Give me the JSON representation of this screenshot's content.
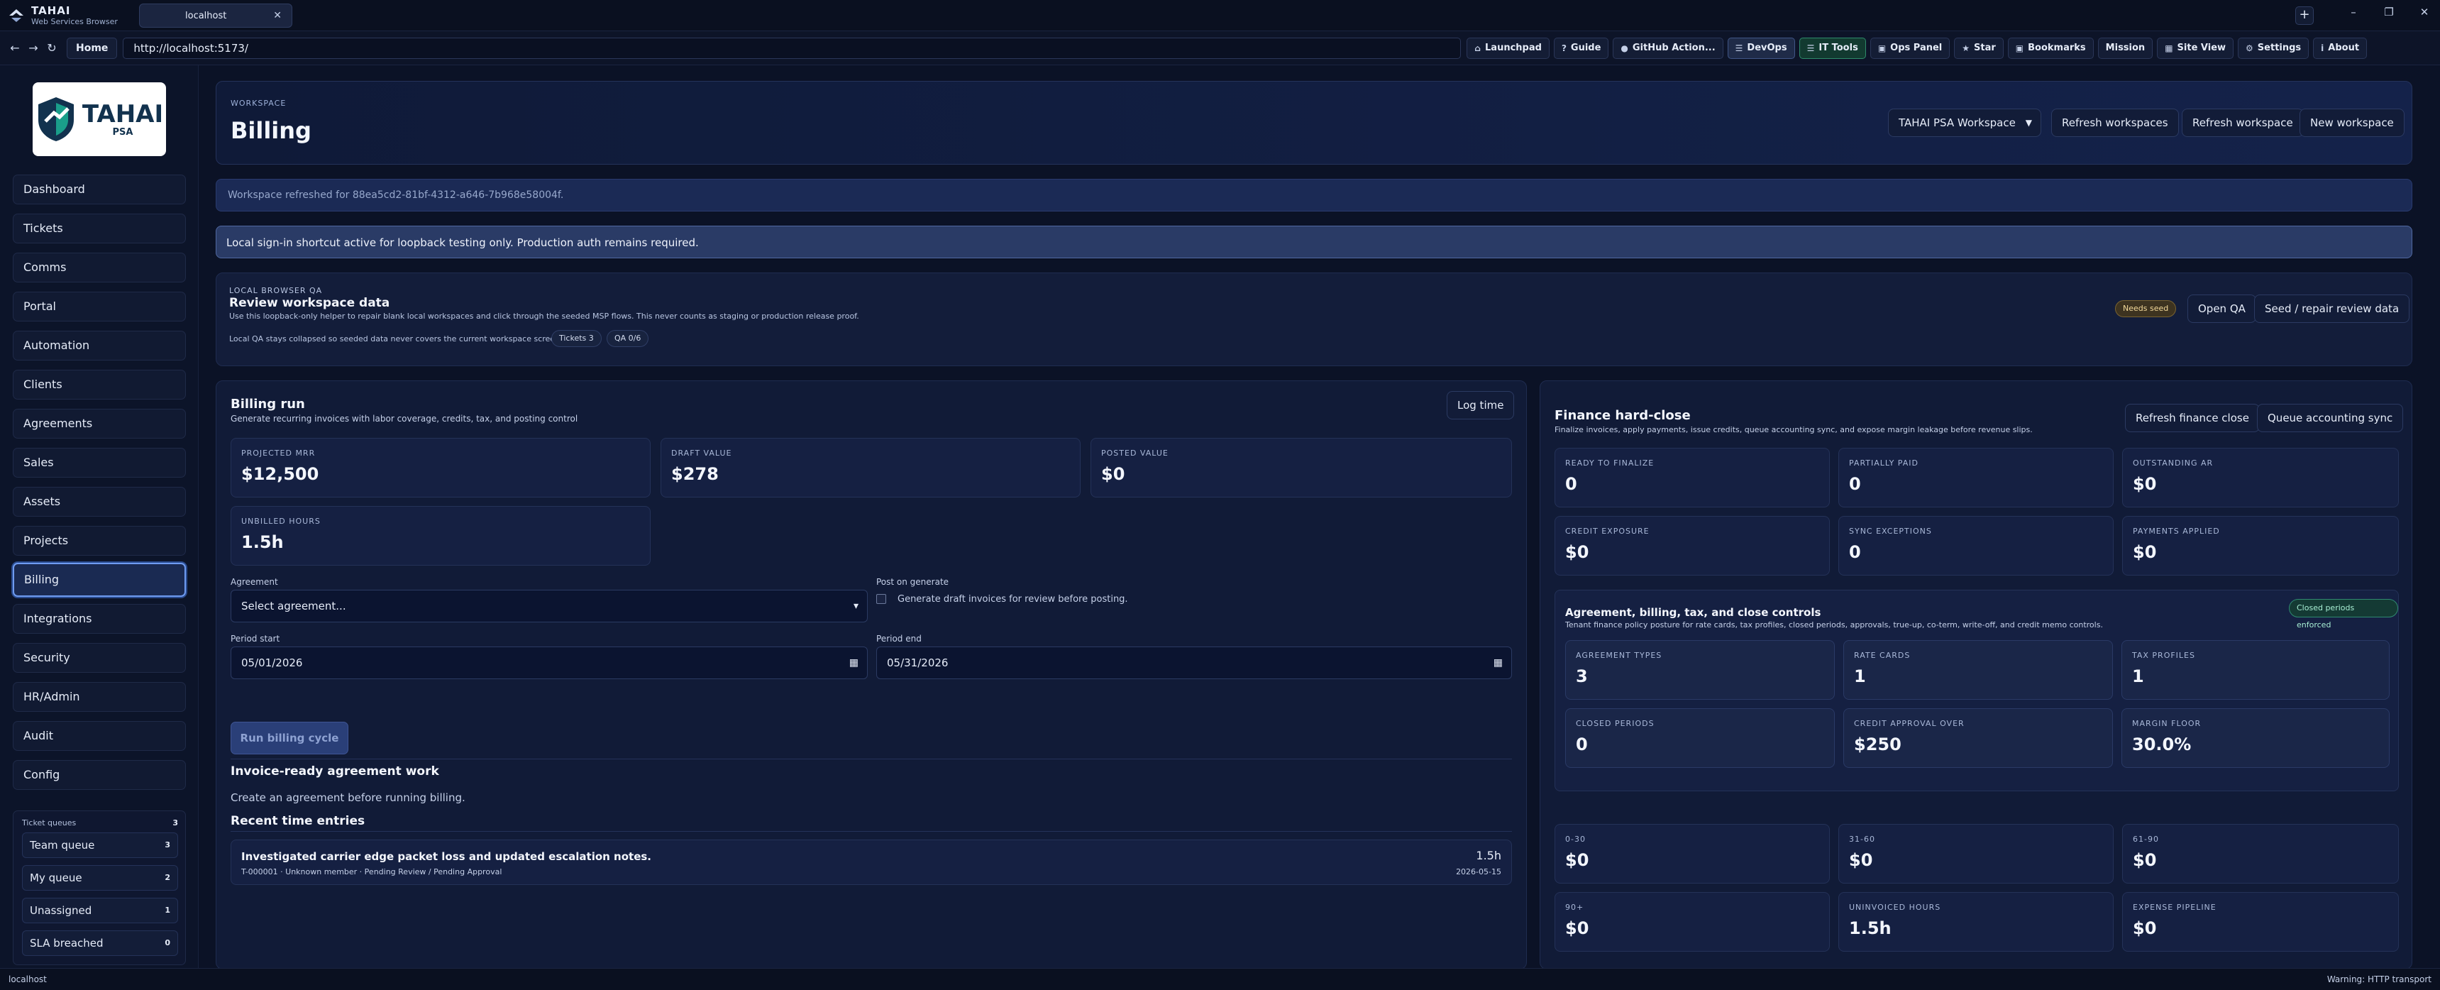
{
  "browser": {
    "brand_name": "TAHAI",
    "brand_sub": "Web Services Browser",
    "tab_title": "localhost",
    "url": "http://localhost:5173/",
    "home_label": "Home",
    "tools": [
      {
        "label": "Launchpad",
        "icon": "⌂"
      },
      {
        "label": "Guide",
        "icon": "?"
      },
      {
        "label": "GitHub Action...",
        "icon": "●"
      },
      {
        "label": "DevOps",
        "icon": "☰"
      },
      {
        "label": "IT Tools",
        "icon": "☰"
      },
      {
        "label": "Ops Panel",
        "icon": "▣"
      },
      {
        "label": "Star",
        "icon": "★"
      },
      {
        "label": "Bookmarks",
        "icon": "▣"
      },
      {
        "label": "Mission",
        "icon": ""
      },
      {
        "label": "Site View",
        "icon": "▦"
      },
      {
        "label": "Settings",
        "icon": "⚙"
      },
      {
        "label": "About",
        "icon": "i"
      }
    ],
    "status_left": "localhost",
    "status_right": "Warning: HTTP transport"
  },
  "app": {
    "logo_text": "TAHAI",
    "logo_sub": "PSA"
  },
  "sidebar": {
    "items": [
      "Dashboard",
      "Tickets",
      "Comms",
      "Portal",
      "Automation",
      "Clients",
      "Agreements",
      "Sales",
      "Assets",
      "Projects",
      "Billing",
      "Integrations",
      "Security",
      "HR/Admin",
      "Audit",
      "Config"
    ],
    "active": "Billing",
    "queues": {
      "title": "Ticket queues",
      "count": "3",
      "items": [
        {
          "label": "Team queue",
          "count": "3"
        },
        {
          "label": "My queue",
          "count": "2"
        },
        {
          "label": "Unassigned",
          "count": "1"
        },
        {
          "label": "SLA breached",
          "count": "0"
        }
      ]
    }
  },
  "header": {
    "eyebrow": "WORKSPACE",
    "title": "Billing",
    "workspace_select": "TAHAI PSA Workspace",
    "refresh_workspaces": "Refresh workspaces",
    "refresh_workspace": "Refresh workspace",
    "new_workspace": "New workspace"
  },
  "notices": {
    "refreshed": "Workspace refreshed for 88ea5cd2-81bf-4312-a646-7b968e58004f.",
    "signin": "Local sign-in shortcut active for loopback testing only. Production auth remains required."
  },
  "qa": {
    "eyebrow": "LOCAL BROWSER QA",
    "title": "Review workspace data",
    "desc": "Use this loopback-only helper to repair blank local workspaces and click through the seeded MSP flows. This never counts as staging or production release proof.",
    "desc2": "Local QA stays collapsed so seeded data never covers the current workspace screen.",
    "pill_tickets": "Tickets 3",
    "pill_qa": "QA 0/6",
    "needs_seed": "Needs seed",
    "open_qa": "Open QA",
    "seed_repair": "Seed / repair review data"
  },
  "billing": {
    "title": "Billing run",
    "subtitle": "Generate recurring invoices with labor coverage, credits, tax, and posting control",
    "log_time": "Log time",
    "stats": [
      {
        "label": "PROJECTED MRR",
        "value": "$12,500"
      },
      {
        "label": "DRAFT VALUE",
        "value": "$278"
      },
      {
        "label": "POSTED VALUE",
        "value": "$0"
      },
      {
        "label": "UNBILLED HOURS",
        "value": "1.5h"
      }
    ],
    "agreement_label": "Agreement",
    "agreement_value": "Select agreement...",
    "post_label": "Post on generate",
    "post_checkbox": "Generate draft invoices for review before posting.",
    "period_start_label": "Period start",
    "period_start": "05/01/2026",
    "period_end_label": "Period end",
    "period_end": "05/31/2026",
    "run_button": "Run billing cycle",
    "invoice_ready_title": "Invoice-ready agreement work",
    "invoice_ready_empty": "Create an agreement before running billing.",
    "recent_title": "Recent time entries",
    "entry": {
      "title": "Investigated carrier edge packet loss and updated escalation notes.",
      "meta": "T-000001 · Unknown member · Pending Review / Pending Approval",
      "hours": "1.5h",
      "date": "2026-05-15"
    }
  },
  "finance": {
    "title": "Finance hard-close",
    "subtitle": "Finalize invoices, apply payments, issue credits, queue accounting sync, and expose margin leakage before revenue slips.",
    "refresh": "Refresh finance close",
    "queue_sync": "Queue accounting sync",
    "stats": [
      {
        "label": "READY TO FINALIZE",
        "value": "0"
      },
      {
        "label": "PARTIALLY PAID",
        "value": "0"
      },
      {
        "label": "OUTSTANDING AR",
        "value": "$0"
      },
      {
        "label": "CREDIT EXPOSURE",
        "value": "$0"
      },
      {
        "label": "SYNC EXCEPTIONS",
        "value": "0"
      },
      {
        "label": "PAYMENTS APPLIED",
        "value": "$0"
      }
    ],
    "controls": {
      "title": "Agreement, billing, tax, and close controls",
      "subtitle": "Tenant finance policy posture for rate cards, tax profiles, closed periods, approvals, true-up, co-term, write-off, and credit memo controls.",
      "badge": "Closed periods enforced",
      "stats": [
        {
          "label": "AGREEMENT TYPES",
          "value": "3"
        },
        {
          "label": "RATE CARDS",
          "value": "1"
        },
        {
          "label": "TAX PROFILES",
          "value": "1"
        },
        {
          "label": "CLOSED PERIODS",
          "value": "0"
        },
        {
          "label": "CREDIT APPROVAL OVER",
          "value": "$250"
        },
        {
          "label": "MARGIN FLOOR",
          "value": "30.0%"
        }
      ]
    },
    "aging": [
      {
        "label": "0-30",
        "value": "$0"
      },
      {
        "label": "31-60",
        "value": "$0"
      },
      {
        "label": "61-90",
        "value": "$0"
      },
      {
        "label": "90+",
        "value": "$0"
      },
      {
        "label": "UNINVOICED HOURS",
        "value": "1.5h"
      },
      {
        "label": "EXPENSE PIPELINE",
        "value": "$0"
      }
    ]
  }
}
